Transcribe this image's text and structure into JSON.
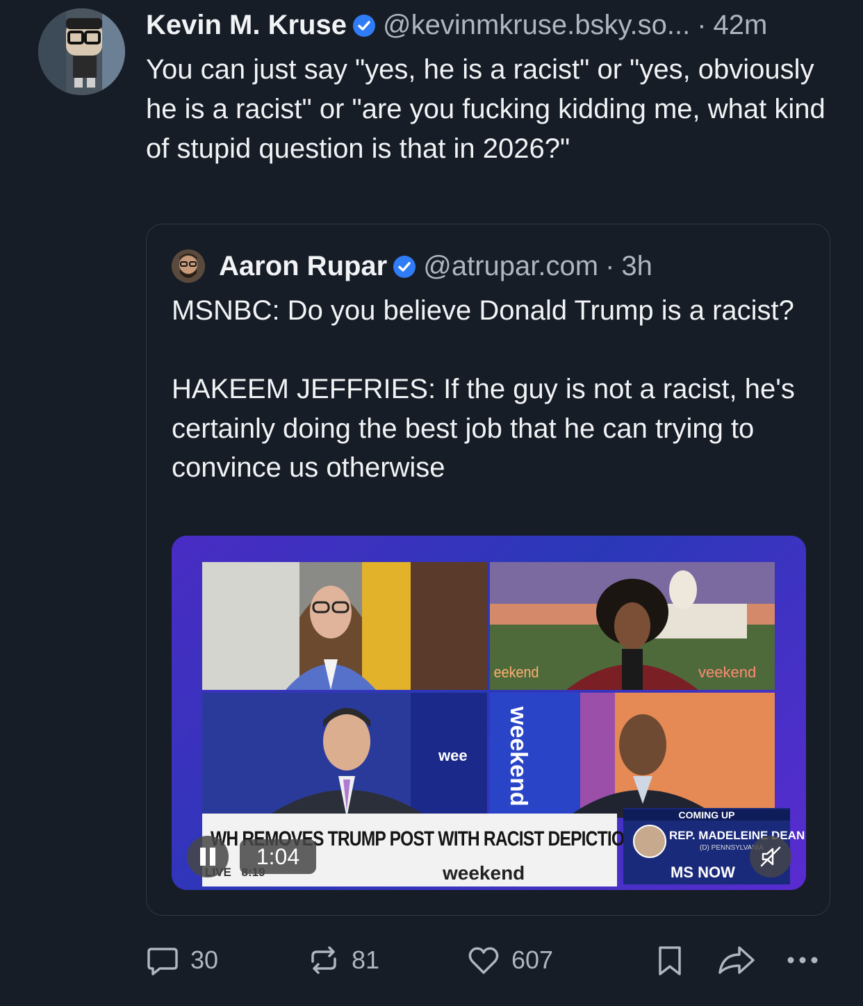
{
  "post": {
    "author_name": "Kevin M. Kruse",
    "handle": "@kevinmkruse.bsky.so...",
    "separator": "·",
    "time": "42m",
    "text": "You can just say \"yes, he is a racist\" or \"yes, obviously he is a racist\" or \"are you fucking kidding me, what kind of stupid question is that in 2026?\""
  },
  "quote": {
    "author_name": "Aaron Rupar",
    "handle": "@atrupar.com",
    "separator": "·",
    "time": "3h",
    "text": "MSNBC: Do you believe Donald Trump is a racist?\n\nHAKEEM JEFFRIES: If the guy is not a racist, he's certainly doing the best job that he can trying to convince us otherwise"
  },
  "video": {
    "chyron": "WH REMOVES TRUMP POST WITH RACIST DEPICTION OF OBAMAS",
    "live_label": "LIVE",
    "clock": "8:19",
    "show_logo": "weekend",
    "coming_up": "COMING UP",
    "guest_name": "REP. MADELEINE DEAN",
    "guest_sub": "(D) PENNSYLVANIA",
    "network": "MS NOW",
    "time_remaining": "1:04",
    "tile_text_1": "eekend",
    "tile_text_2": "veekend",
    "tile_text_3": "wee",
    "tile_text_4": "weekend"
  },
  "actions": {
    "replies": "30",
    "reposts": "81",
    "likes": "607"
  },
  "colors": {
    "background": "#171d27",
    "muted_text": "#aeb6bf",
    "verified_blue": "#2f7cf6",
    "quote_border": "#2d3845"
  }
}
